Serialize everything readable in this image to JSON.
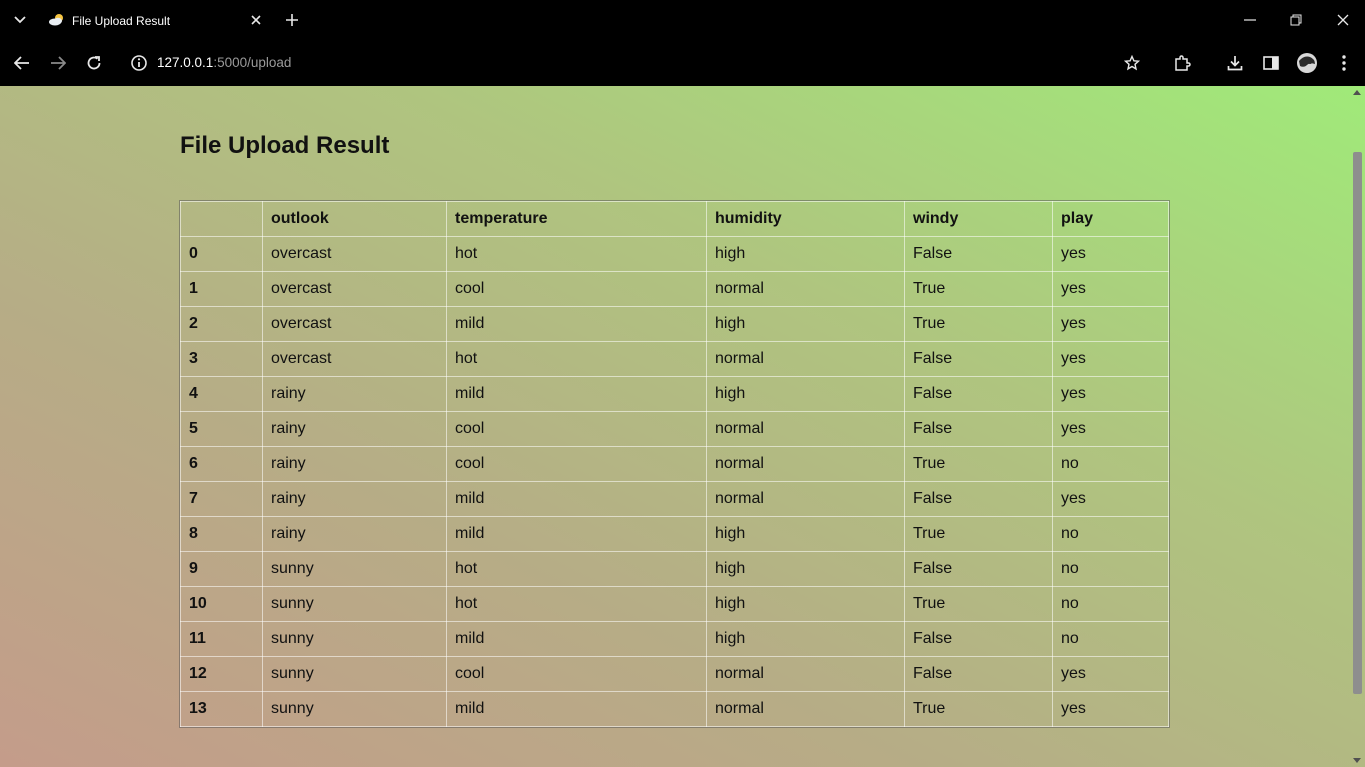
{
  "browser": {
    "tab_title": "File Upload Result",
    "url_host": "127.0.0.1",
    "url_path": ":5000/upload"
  },
  "page": {
    "title": "File Upload Result"
  },
  "table": {
    "columns": [
      "",
      "outlook",
      "temperature",
      "humidity",
      "windy",
      "play"
    ],
    "rows": [
      [
        "0",
        "overcast",
        "hot",
        "high",
        "False",
        "yes"
      ],
      [
        "1",
        "overcast",
        "cool",
        "normal",
        "True",
        "yes"
      ],
      [
        "2",
        "overcast",
        "mild",
        "high",
        "True",
        "yes"
      ],
      [
        "3",
        "overcast",
        "hot",
        "normal",
        "False",
        "yes"
      ],
      [
        "4",
        "rainy",
        "mild",
        "high",
        "False",
        "yes"
      ],
      [
        "5",
        "rainy",
        "cool",
        "normal",
        "False",
        "yes"
      ],
      [
        "6",
        "rainy",
        "cool",
        "normal",
        "True",
        "no"
      ],
      [
        "7",
        "rainy",
        "mild",
        "normal",
        "False",
        "yes"
      ],
      [
        "8",
        "rainy",
        "mild",
        "high",
        "True",
        "no"
      ],
      [
        "9",
        "sunny",
        "hot",
        "high",
        "False",
        "no"
      ],
      [
        "10",
        "sunny",
        "hot",
        "high",
        "True",
        "no"
      ],
      [
        "11",
        "sunny",
        "mild",
        "high",
        "False",
        "no"
      ],
      [
        "12",
        "sunny",
        "cool",
        "normal",
        "False",
        "yes"
      ],
      [
        "13",
        "sunny",
        "mild",
        "normal",
        "True",
        "yes"
      ]
    ]
  },
  "colors": {
    "chrome_bg": "#000000",
    "gradient_start": "#c49c8a",
    "gradient_end": "#a0ea79"
  }
}
